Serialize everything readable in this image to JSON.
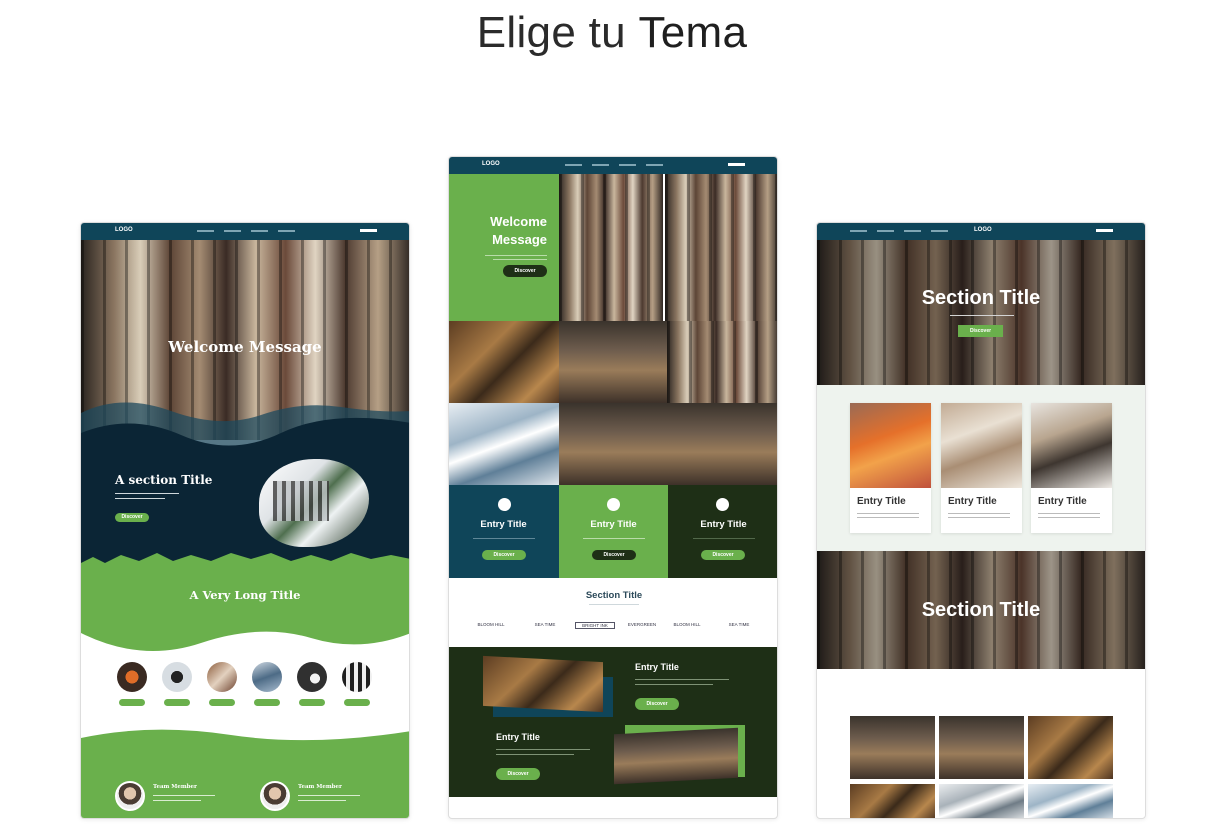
{
  "heading": {
    "prefix": "Elige tu",
    "emphasis": "Tema"
  },
  "colors": {
    "navy": "#0f4559",
    "green": "#6ab04c",
    "dark_green": "#1e2f16",
    "dark_navy": "#0b2535"
  },
  "theme1": {
    "logo": "LOGO",
    "hero_title": "Welcome Message",
    "section_title": "A section Title",
    "section_button": "Discover",
    "long_title": "A Very Long Title",
    "team": [
      {
        "label": "Team Member"
      },
      {
        "label": "Team Member"
      }
    ]
  },
  "theme2": {
    "logo": "LOGO",
    "welcome_line1": "Welcome",
    "welcome_line2": "Message",
    "welcome_button": "Discover",
    "columns": [
      {
        "title": "Entry Title",
        "button": "Discover"
      },
      {
        "title": "Entry Title",
        "button": "Discover"
      },
      {
        "title": "Entry Title",
        "button": "Discover"
      }
    ],
    "section_title": "Section Title",
    "brands": [
      "BLOOM HILL",
      "SEA TIME",
      "BRIGHT INK",
      "EVERGREEN",
      "BLOOM HILL",
      "SEA TIME"
    ],
    "entry1_title": "Entry Title",
    "entry1_button": "Discover",
    "entry2_title": "Entry Title",
    "entry2_button": "Discover"
  },
  "theme3": {
    "logo": "LOGO",
    "hero_title": "Section Title",
    "hero_button": "Discover",
    "entries": [
      {
        "title": "Entry Title"
      },
      {
        "title": "Entry Title"
      },
      {
        "title": "Entry Title"
      }
    ],
    "section2_title": "Section Title"
  }
}
